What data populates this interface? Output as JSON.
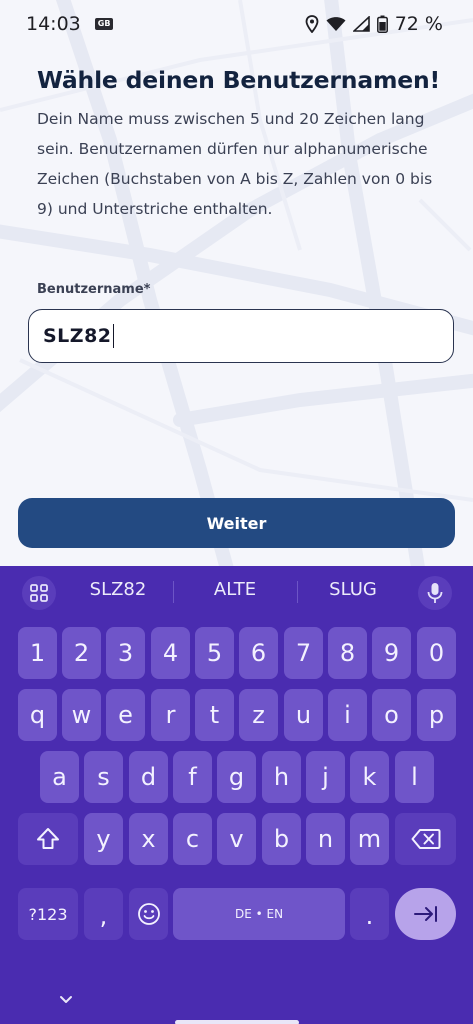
{
  "status_bar": {
    "time": "14:03",
    "badge": "GB",
    "battery_percent": "72 %"
  },
  "page": {
    "title": "Wähle deinen Benutzernamen!",
    "description": "Dein Name muss zwischen 5 und 20 Zeichen lang sein. Benutzernamen dürfen nur alphanumerische Zeichen (Buchstaben von A bis Z, Zahlen von 0 bis 9) und Unterstriche enthalten.",
    "field_label": "Benutzername",
    "field_required_mark": "*",
    "field_value": "SLZ82",
    "continue_label": "Weiter"
  },
  "keyboard": {
    "suggestions": [
      "SLZ82",
      "ALTE",
      "SLUG"
    ],
    "row_numbers": [
      "1",
      "2",
      "3",
      "4",
      "5",
      "6",
      "7",
      "8",
      "9",
      "0"
    ],
    "row_1": [
      "q",
      "w",
      "e",
      "r",
      "t",
      "z",
      "u",
      "i",
      "o",
      "p"
    ],
    "row_2": [
      "a",
      "s",
      "d",
      "f",
      "g",
      "h",
      "j",
      "k",
      "l"
    ],
    "row_3": [
      "y",
      "x",
      "c",
      "v",
      "b",
      "n",
      "m"
    ],
    "symbols_label": "?123",
    "comma_label": ",",
    "space_label": "DE • EN",
    "period_label": ".",
    "icons": {
      "grid": "grid-icon",
      "mic": "microphone-icon",
      "shift": "shift-icon",
      "backspace": "backspace-icon",
      "emoji": "emoji-icon",
      "enter": "enter-icon",
      "nav_down": "chevron-down-icon"
    }
  },
  "colors": {
    "keyboard_bg": "#4a2cb0",
    "key_bg": "#6f55c9",
    "fn_key_bg": "#5a3dbb",
    "enter_key_bg": "#b7a3ea",
    "button_bg": "#234a82",
    "title_color": "#13233f"
  }
}
